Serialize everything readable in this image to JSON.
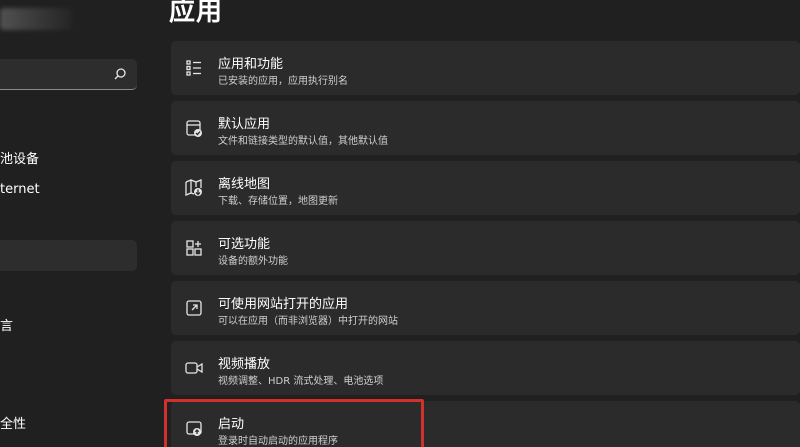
{
  "sidebar": {
    "search": {
      "icon": "search-icon"
    },
    "items": [
      {
        "label": "池设备",
        "icon": ""
      },
      {
        "label": "ternet",
        "icon": ""
      },
      {
        "label": "",
        "icon": ""
      },
      {
        "label": "言",
        "icon": ""
      },
      {
        "label": "全性",
        "icon": ""
      }
    ]
  },
  "main": {
    "title": "应用",
    "cards": [
      {
        "title": "应用和功能",
        "subtitle": "已安装的应用，应用执行别名",
        "icon": "apps-list-icon"
      },
      {
        "title": "默认应用",
        "subtitle": "文件和链接类型的默认值，其他默认值",
        "icon": "default-apps-icon"
      },
      {
        "title": "离线地图",
        "subtitle": "下载、存储位置，地图更新",
        "icon": "offline-maps-icon"
      },
      {
        "title": "可选功能",
        "subtitle": "设备的额外功能",
        "icon": "optional-features-icon"
      },
      {
        "title": "可使用网站打开的应用",
        "subtitle": "可以在应用（而非浏览器）中打开的网站",
        "icon": "apps-for-websites-icon"
      },
      {
        "title": "视频播放",
        "subtitle": "视频调整、HDR 流式处理、电池选项",
        "icon": "video-playback-icon"
      },
      {
        "title": "启动",
        "subtitle": "登录时自动启动的应用程序",
        "icon": "startup-icon"
      }
    ]
  },
  "colors": {
    "background": "#202020",
    "card": "#2b2b2b",
    "highlight": "#d2302c"
  }
}
